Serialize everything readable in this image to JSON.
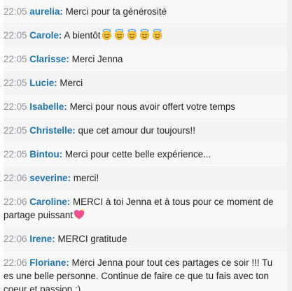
{
  "messages": [
    {
      "time": "22:05",
      "user": "aurelia:",
      "text": "Merci pour ta générosité",
      "emoji": []
    },
    {
      "time": "22:05",
      "user": "Carole:",
      "text": "A bientôt",
      "emoji": [
        "innocent",
        "innocent",
        "innocent",
        "innocent",
        "innocent"
      ]
    },
    {
      "time": "22:05",
      "user": "Clarisse:",
      "text": "Merci Jenna",
      "emoji": []
    },
    {
      "time": "22:05",
      "user": "Lucie:",
      "text": "Merci",
      "emoji": []
    },
    {
      "time": "22:05",
      "user": "Isabelle:",
      "text": "Merci pour nous avoir offert votre temps",
      "emoji": []
    },
    {
      "time": "22:05",
      "user": "Christelle:",
      "text": "que cet amour dur toujours!!",
      "emoji": []
    },
    {
      "time": "22:05",
      "user": "Bintou:",
      "text": "Merci pour cette belle expérience...",
      "emoji": []
    },
    {
      "time": "22:06",
      "user": "severine:",
      "text": "merci!",
      "emoji": []
    },
    {
      "time": "22:06",
      "user": "Caroline:",
      "text": "MERCI à toi Jenna et à tous pour ce moment de partage puissant",
      "emoji": [
        "sparkling-heart"
      ]
    },
    {
      "time": "22:06",
      "user": "Irene:",
      "text": "MERCI gratitude",
      "emoji": []
    },
    {
      "time": "22:06",
      "user": "Floriane:",
      "text": "Merci Jenna pour tout ces partages ce soir !!! Tu es une belle personne. Continue de faire ce que tu fais avec ton coeur et passion :)",
      "emoji": []
    }
  ],
  "colors": {
    "timestamp": "#8f9299",
    "username": "#1f73a8",
    "text": "#1f1f1f"
  }
}
